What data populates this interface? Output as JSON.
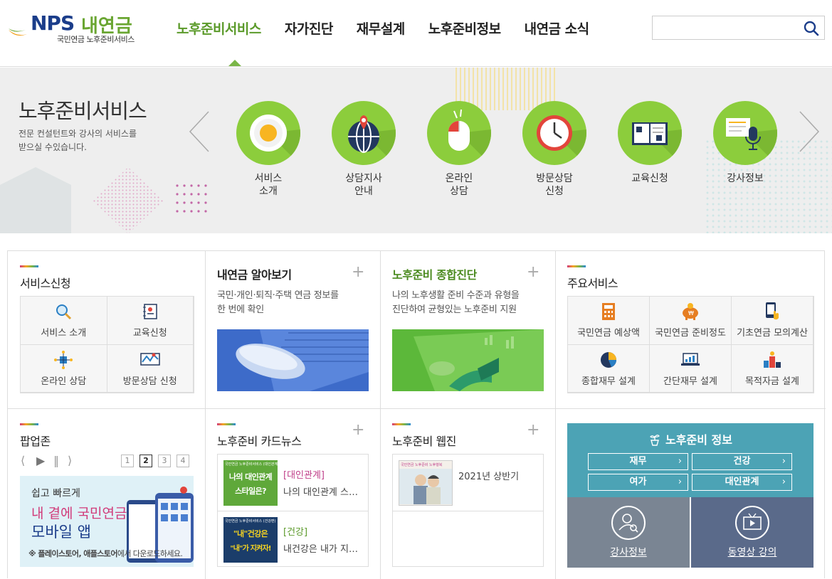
{
  "header": {
    "logo_brand": "NPS",
    "logo_name": "내연금",
    "logo_sub": "국민연금 노후준비서비스",
    "nav": [
      "노후준비서비스",
      "자가진단",
      "재무설계",
      "노후준비정보",
      "내연금 소식"
    ],
    "active_nav": "노후준비서비스",
    "search_placeholder": "",
    "search_icon": "search-icon"
  },
  "hero": {
    "title": "노후준비서비스",
    "desc_line1": "전문 컨설턴트와 강사의 서비스를",
    "desc_line2": "받으실 수있습니다.",
    "services": [
      {
        "line1": "서비스",
        "line2": "소개",
        "icon": "egg-plate-icon"
      },
      {
        "line1": "상담지사",
        "line2": "안내",
        "icon": "globe-pin-icon"
      },
      {
        "line1": "온라인",
        "line2": "상담",
        "icon": "mouse-icon"
      },
      {
        "line1": "방문상담",
        "line2": "신청",
        "icon": "clock-icon"
      },
      {
        "line1": "교육신청",
        "line2": "",
        "icon": "book-icon"
      },
      {
        "line1": "강사정보",
        "line2": "",
        "icon": "microphone-icon"
      }
    ],
    "accent_color": "#8ccd3c"
  },
  "service_apply": {
    "title": "서비스신청",
    "items": [
      {
        "label": "서비스 소개",
        "icon": "magnifier-icon"
      },
      {
        "label": "교육신청",
        "icon": "notebook-icon"
      },
      {
        "label": "온라인 상담",
        "icon": "network-icon"
      },
      {
        "label": "방문상담 신청",
        "icon": "map-icon"
      }
    ]
  },
  "my_pension": {
    "title": "내연금 알아보기",
    "desc_line1": "국민·개인·퇴직·주택 연금 정보를",
    "desc_line2": "한 번에 확인"
  },
  "diagnosis": {
    "title": "노후준비 종합진단",
    "desc_line1": "나의 노후생활 준비 수준과 유형을",
    "desc_line2": "진단하여 균형있는 노후준비 지원"
  },
  "main_services": {
    "title": "주요서비스",
    "items": [
      {
        "label": "국민연금 예상액",
        "icon": "calculator-icon"
      },
      {
        "label": "국민연금 준비정도",
        "icon": "piggy-bank-icon"
      },
      {
        "label": "기초연금 모의계산",
        "icon": "phone-touch-icon"
      },
      {
        "label": "종합재무 설계",
        "icon": "pie-chart-icon"
      },
      {
        "label": "간단재무 설계",
        "icon": "laptop-chart-icon"
      },
      {
        "label": "목적자금 설계",
        "icon": "podium-icon"
      }
    ]
  },
  "popup_zone": {
    "title": "팝업존",
    "pages": [
      "1",
      "2",
      "3",
      "4"
    ],
    "current_page": "2",
    "banner_line1": "쉽고 빠르게",
    "banner_line2": "내 곁에 국민연금",
    "banner_line3": "모바일 앱",
    "banner_note_strong": "※ 플레이스토어, 애플스토어",
    "banner_note_rest": "에서 다운로드하세요."
  },
  "card_news": {
    "title": "노후준비 카드뉴스",
    "items": [
      {
        "tag": "[대인관계]",
        "text": "나의 대인관계 스…",
        "thumb_header": "국민연금 노후준비서비스 (대인관계)",
        "thumb_line1": "나의 대인관계",
        "thumb_line2": "스타일은?",
        "tag_color": "#c0408a"
      },
      {
        "tag": "[건강]",
        "text": "내건강은 내가 지…",
        "thumb_header": "국민연금 노후준비서비스 (건강편)",
        "thumb_line1": "\"내\"건강은",
        "thumb_line2": "\"내\"가 지켜자!",
        "tag_color": "#5b9a2a"
      }
    ]
  },
  "webzine": {
    "title": "노후준비 웹진",
    "items": [
      {
        "text": "2021년 상반기",
        "thumb_header": "국민연금 노후준비 노후행복"
      }
    ]
  },
  "info": {
    "title": "노후준비 정보",
    "buttons": [
      "재무",
      "건강",
      "여가",
      "대인관계"
    ],
    "lecturer": "강사정보",
    "video": "동영상 강의",
    "colors": {
      "teal": "#4ca3b5",
      "gray": "#7a8593",
      "navy": "#5a6a8a"
    }
  }
}
